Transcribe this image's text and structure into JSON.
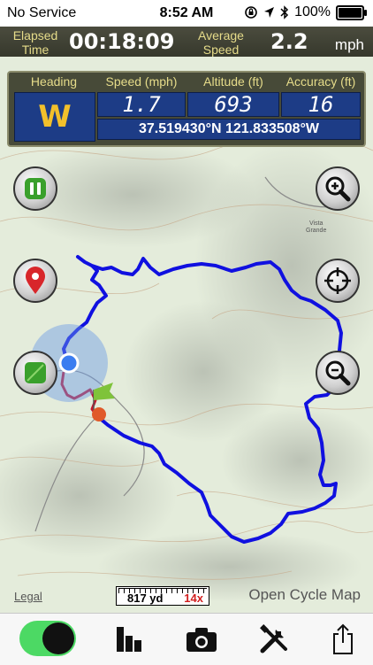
{
  "status_bar": {
    "carrier": "No Service",
    "time": "8:52 AM",
    "battery_percent": "100%",
    "battery_level": 1.0,
    "icons": [
      "lock-rotation-icon",
      "location-arrow-icon",
      "bluetooth-icon",
      "battery-icon"
    ]
  },
  "trip": {
    "elapsed_label_line1": "Elapsed",
    "elapsed_label_line2": "Time",
    "elapsed_value": "00:18:09",
    "avg_label_line1": "Average",
    "avg_label_line2": "Speed",
    "avg_value": "2.2",
    "avg_unit": "mph"
  },
  "info_panel": {
    "heading_label": "Heading",
    "heading_value": "W",
    "speed_label": "Speed (mph)",
    "speed_value": "1.7",
    "altitude_label": "Altitude (ft)",
    "altitude_value": "693",
    "accuracy_label": "Accuracy (ft)",
    "accuracy_value": "16",
    "coordinates": "37.519430°N 121.833508°W"
  },
  "map": {
    "place_label": "Vista Grande",
    "legal_link": "Legal",
    "scale_distance": "817 yd",
    "zoom_level": "14x",
    "attribution": "Open Cycle Map",
    "track_color": "#1010e0",
    "recent_track_color": "#c4162e",
    "location_dot_color": "#3b7df0"
  },
  "buttons": {
    "pause": "pause-icon",
    "waypoint": "map-pin-icon",
    "map_layer": "map-layer-icon",
    "zoom_in": "zoom-in-icon",
    "center": "crosshair-icon",
    "zoom_out": "zoom-out-icon"
  },
  "toolbar": {
    "tracking_toggle_on": true,
    "icons": [
      "bar-chart-icon",
      "camera-icon",
      "tools-icon",
      "share-icon"
    ]
  }
}
